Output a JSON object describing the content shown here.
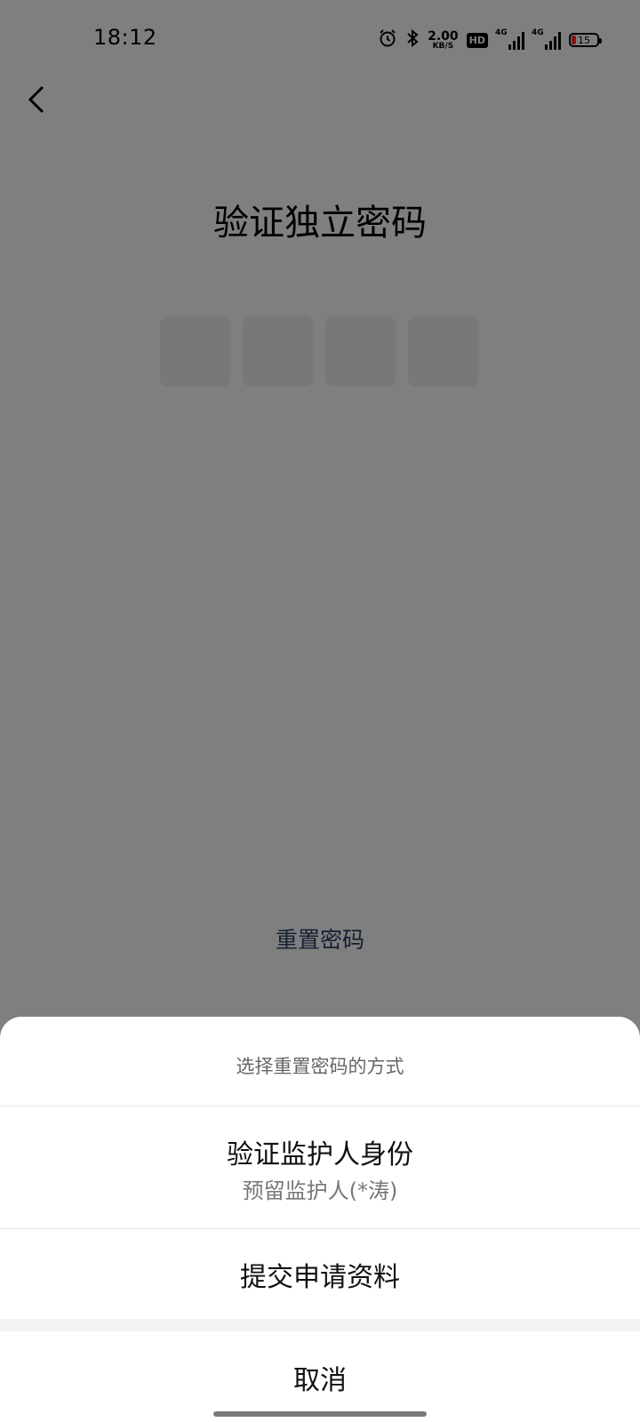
{
  "status_bar": {
    "time": "18:12",
    "net_speed_value": "2.00",
    "net_speed_unit": "KB/S",
    "hd_label": "HD",
    "signal1_label": "4G",
    "signal2_label": "4G",
    "battery_level": "15",
    "battery_color": "#ff2d2d"
  },
  "header": {
    "back_icon": "chevron-left-icon"
  },
  "main": {
    "title": "验证独立密码",
    "pin_boxes": 4,
    "reset_link": "重置密码",
    "link_color": "#2c3e66"
  },
  "sheet": {
    "title": "选择重置密码的方式",
    "options": [
      {
        "label": "验证监护人身份",
        "sublabel": "预留监护人(*涛)"
      },
      {
        "label": "提交申请资料"
      }
    ],
    "cancel": "取消"
  }
}
